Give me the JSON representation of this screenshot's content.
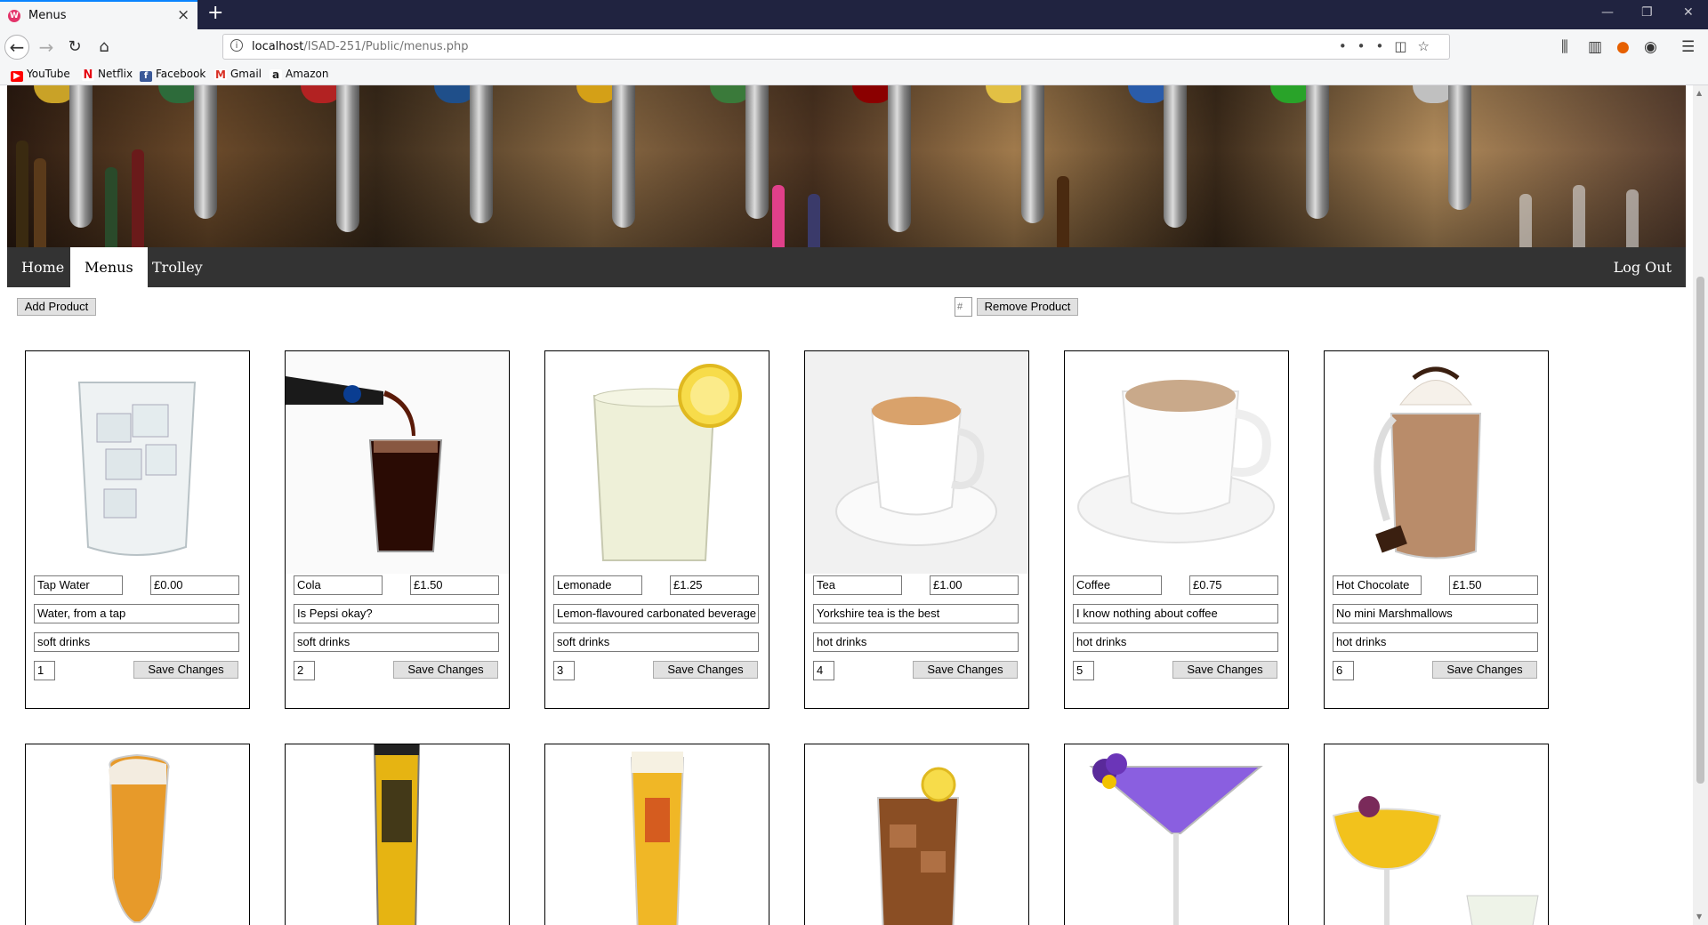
{
  "browser": {
    "tab_title": "Menus",
    "tab_favicon": "firefox-tab-favicon",
    "url_host": "localhost",
    "url_path": "/ISAD-251/Public/menus.php",
    "bookmarks": [
      {
        "label": "YouTube",
        "icon": "youtube-icon",
        "color": "#ff0000"
      },
      {
        "label": "Netflix",
        "icon": "netflix-icon",
        "color": "#e50914"
      },
      {
        "label": "Facebook",
        "icon": "facebook-icon",
        "color": "#3b5998"
      },
      {
        "label": "Gmail",
        "icon": "gmail-icon",
        "color": "#d93025"
      },
      {
        "label": "Amazon",
        "icon": "amazon-icon",
        "color": "#222222"
      }
    ]
  },
  "nav": {
    "items": [
      "Home",
      "Menus",
      "Trolley"
    ],
    "active": "Menus",
    "logout": "Log Out"
  },
  "toolbar": {
    "add_label": "Add Product",
    "remove_placeholder": "#",
    "remove_label": "Remove Product"
  },
  "products": [
    {
      "name": "Tap Water",
      "price": "£0.00",
      "description": "Water, from a tap",
      "category": "soft drinks",
      "id": "1",
      "save": "Save Changes",
      "image": "tap-water-glass"
    },
    {
      "name": "Cola",
      "price": "£1.50",
      "description": "Is Pepsi okay?",
      "category": "soft drinks",
      "id": "2",
      "save": "Save Changes",
      "image": "cola-pour"
    },
    {
      "name": "Lemonade",
      "price": "£1.25",
      "description": "Lemon-flavoured carbonated beverage",
      "category": "soft drinks",
      "id": "3",
      "save": "Save Changes",
      "image": "lemonade-glass"
    },
    {
      "name": "Tea",
      "price": "£1.00",
      "description": "Yorkshire tea is the best",
      "category": "hot drinks",
      "id": "4",
      "save": "Save Changes",
      "image": "tea-cup"
    },
    {
      "name": "Coffee",
      "price": "£0.75",
      "description": "I know nothing about coffee",
      "category": "hot drinks",
      "id": "5",
      "save": "Save Changes",
      "image": "coffee-cup"
    },
    {
      "name": "Hot Chocolate",
      "price": "£1.50",
      "description": "No mini Marshmallows",
      "category": "hot drinks",
      "id": "6",
      "save": "Save Changes",
      "image": "hot-chocolate-mug"
    }
  ],
  "second_row_images": [
    "beer-glass",
    "cider-glass",
    "lager-glass",
    "iced-tea-glass",
    "purple-cocktail",
    "yellow-cocktail"
  ]
}
